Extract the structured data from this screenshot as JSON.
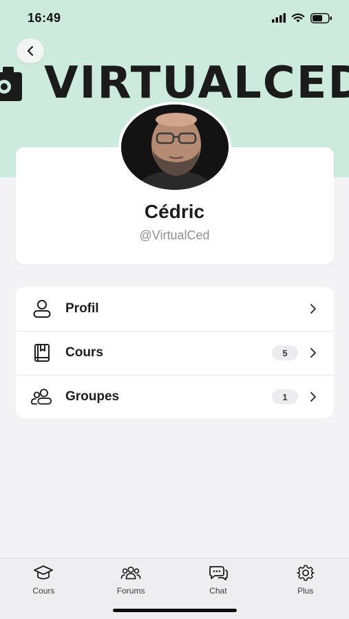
{
  "status_bar": {
    "time": "16:49"
  },
  "banner": {
    "text": "VIRTUALCED"
  },
  "profile": {
    "name": "Cédric",
    "handle": "@VirtualCed"
  },
  "menu": {
    "items": [
      {
        "label": "Profil",
        "icon": "person-icon",
        "badge": ""
      },
      {
        "label": "Cours",
        "icon": "book-icon",
        "badge": "5"
      },
      {
        "label": "Groupes",
        "icon": "group-icon",
        "badge": "1"
      }
    ]
  },
  "tabbar": {
    "items": [
      {
        "label": "Cours",
        "icon": "graduation-cap-icon"
      },
      {
        "label": "Forums",
        "icon": "people-icon"
      },
      {
        "label": "Chat",
        "icon": "chat-bubbles-icon"
      },
      {
        "label": "Plus",
        "icon": "gear-icon"
      }
    ]
  },
  "colors": {
    "cover": "#cdeade",
    "background": "#f3f3f6",
    "card": "#ffffff"
  }
}
